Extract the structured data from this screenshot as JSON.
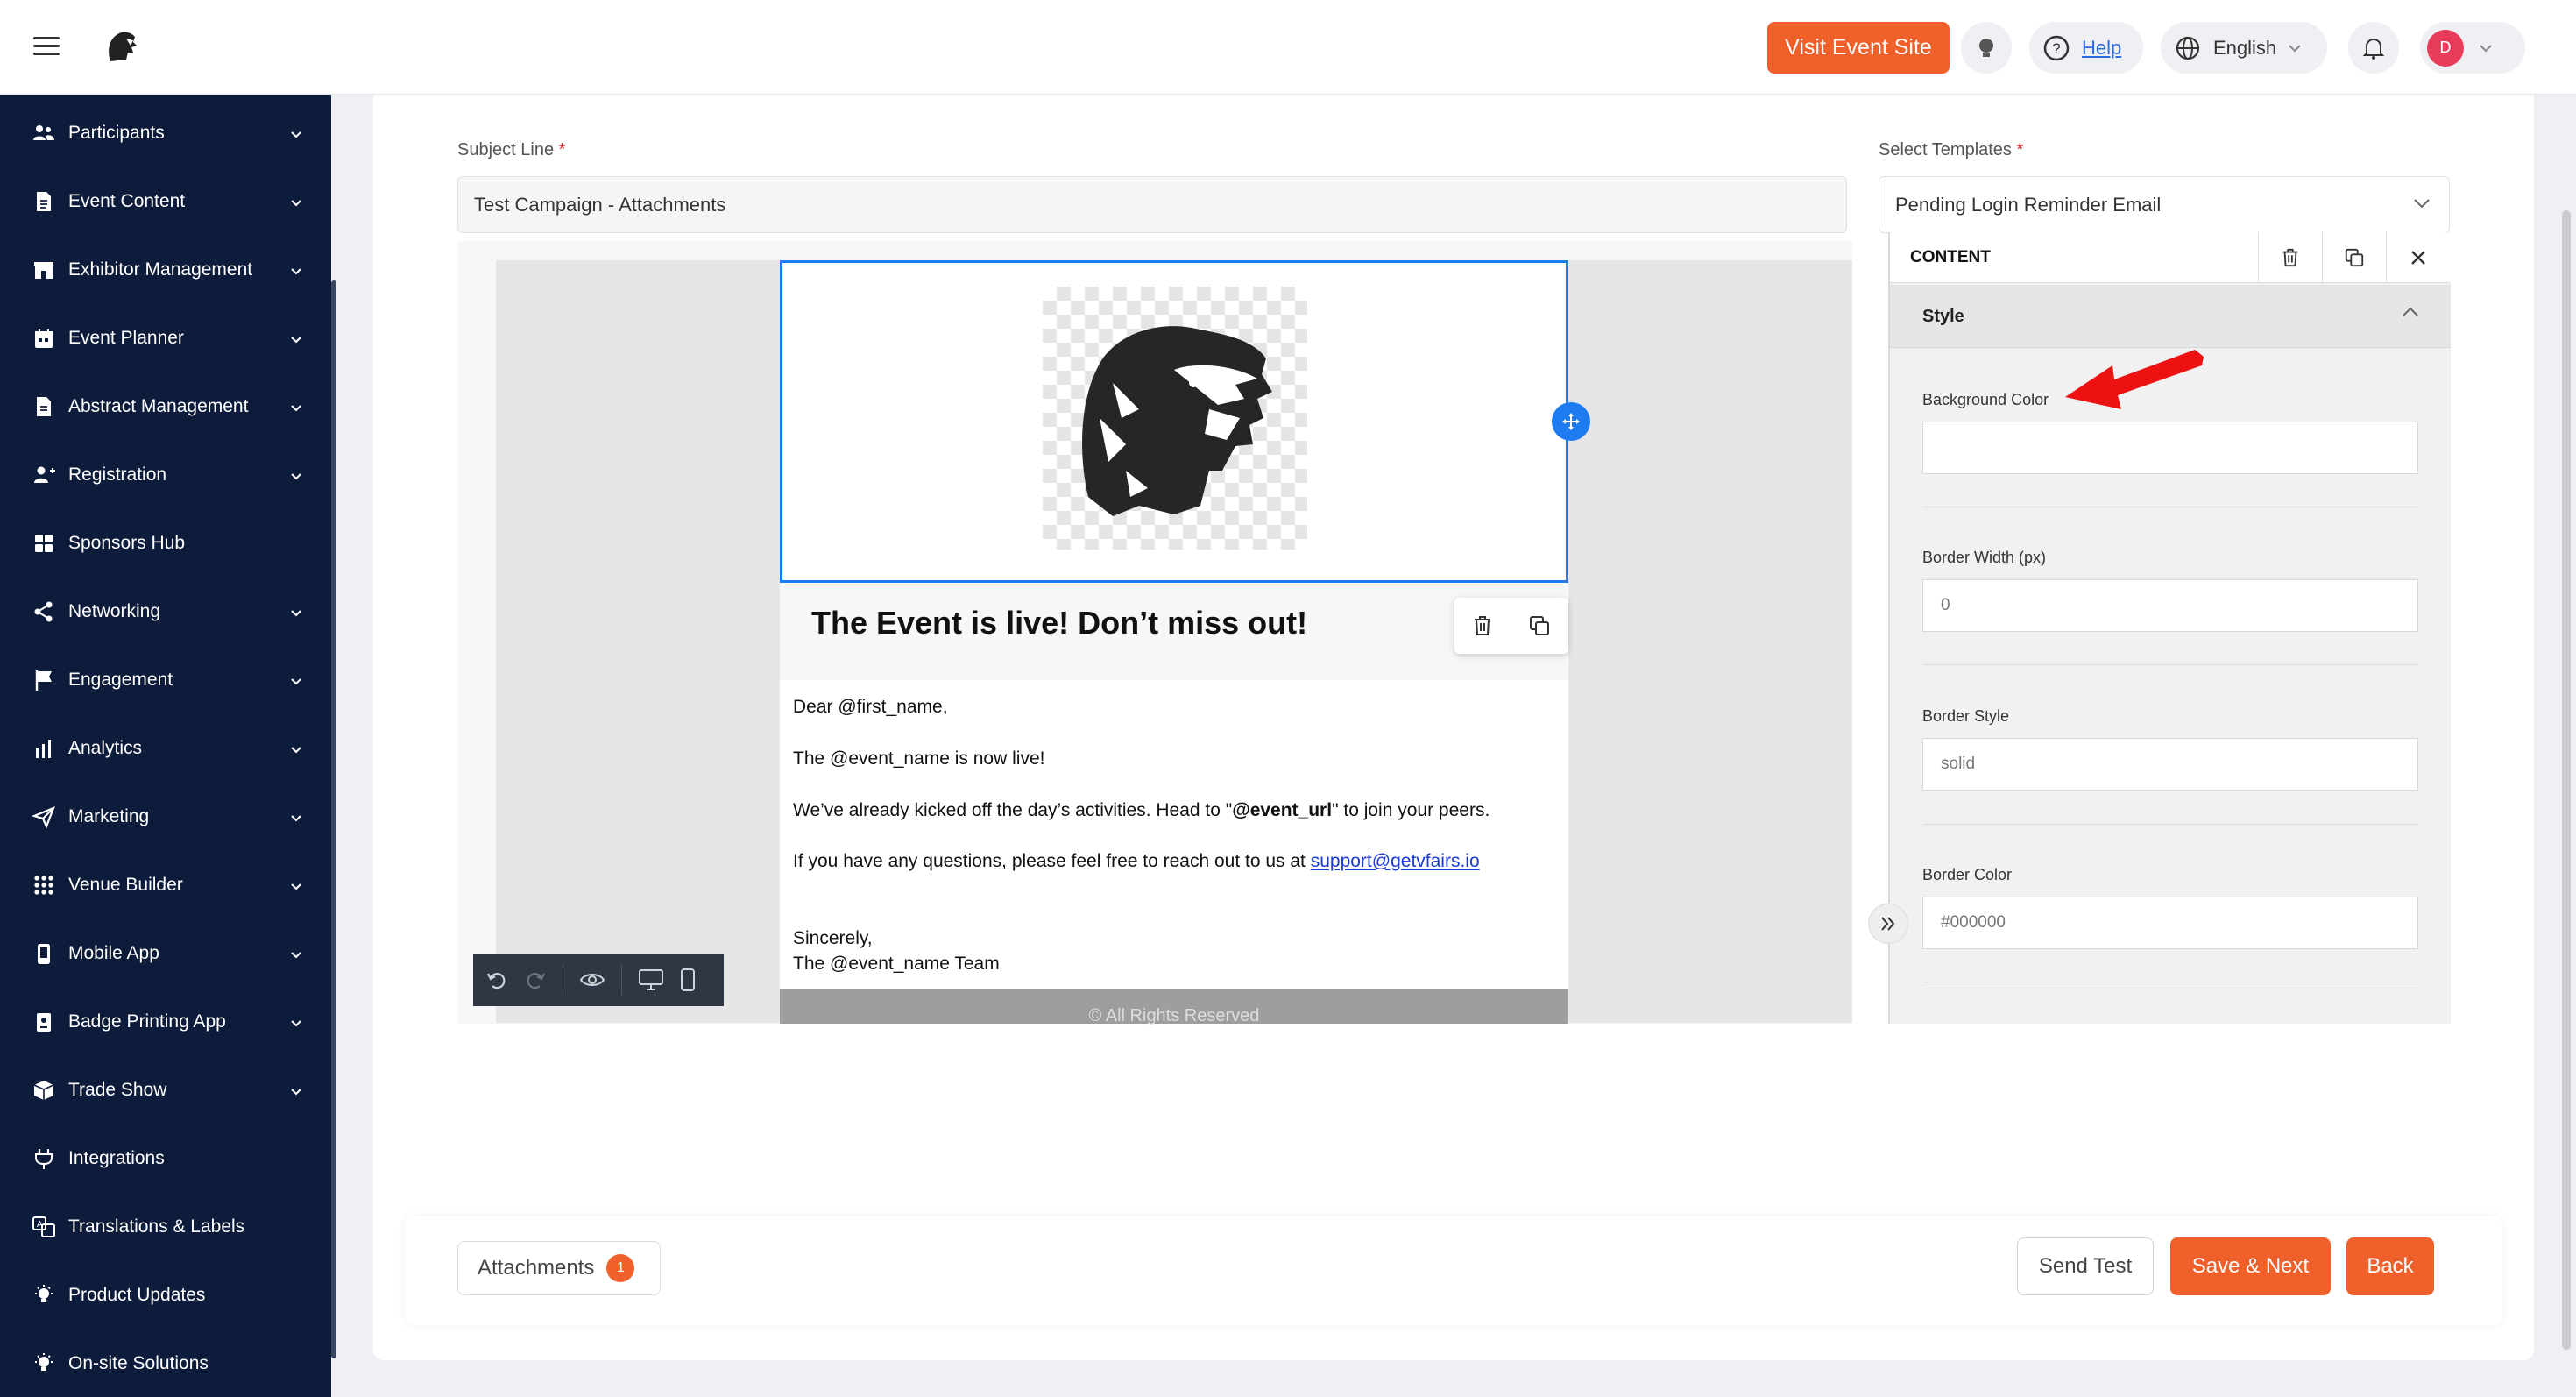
{
  "topbar": {
    "visit_label": "Visit Event Site",
    "help_label": "Help",
    "language": "English",
    "user_initial": "D",
    "accent": "#f0602a"
  },
  "sidebar": {
    "items": [
      {
        "label": "Participants",
        "icon": "users-icon",
        "chevron": true
      },
      {
        "label": "Event Content",
        "icon": "document-icon",
        "chevron": true
      },
      {
        "label": "Exhibitor Management",
        "icon": "booth-icon",
        "chevron": true
      },
      {
        "label": "Event Planner",
        "icon": "calendar-icon",
        "chevron": true
      },
      {
        "label": "Abstract Management",
        "icon": "file-icon",
        "chevron": true
      },
      {
        "label": "Registration",
        "icon": "user-plus-icon",
        "chevron": true
      },
      {
        "label": "Sponsors Hub",
        "icon": "grid-icon",
        "chevron": false
      },
      {
        "label": "Networking",
        "icon": "share-icon",
        "chevron": true
      },
      {
        "label": "Engagement",
        "icon": "flag-icon",
        "chevron": true
      },
      {
        "label": "Analytics",
        "icon": "bar-chart-icon",
        "chevron": true
      },
      {
        "label": "Marketing",
        "icon": "send-icon",
        "chevron": true
      },
      {
        "label": "Venue Builder",
        "icon": "dots-grid-icon",
        "chevron": true
      },
      {
        "label": "Mobile App",
        "icon": "mobile-icon",
        "chevron": true
      },
      {
        "label": "Badge Printing App",
        "icon": "badge-icon",
        "chevron": true
      },
      {
        "label": "Trade Show",
        "icon": "box-icon",
        "chevron": true
      },
      {
        "label": "Integrations",
        "icon": "plug-icon",
        "chevron": false
      },
      {
        "label": "Translations & Labels",
        "icon": "translate-icon",
        "chevron": false
      },
      {
        "label": "Product Updates",
        "icon": "lightbulb-icon",
        "chevron": false
      },
      {
        "label": "On-site Solutions",
        "icon": "lightbulb-icon",
        "chevron": false
      }
    ]
  },
  "form": {
    "subject_label": "Subject Line",
    "subject_value": "Test Campaign - Attachments",
    "template_label": "Select Templates",
    "template_value": "Pending Login Reminder Email",
    "required_mark": "*"
  },
  "email": {
    "headline": "The Event is live! Don’t miss out!",
    "greeting": "Dear @first_name,",
    "line1": "The @event_name is now live!",
    "line2_pre": "We’ve already kicked off the day’s activities. Head to \"",
    "line2_bold": "@event_url",
    "line2_post": "\" to join your peers.",
    "line3_pre": "If you have any questions, please feel free to reach out to us at ",
    "line3_link": "support@getvfairs.io",
    "signoff": "Sincerely,",
    "team": "The @event_name Team",
    "footer": "© All Rights Reserved"
  },
  "panel": {
    "tab": "CONTENT",
    "section": "Style",
    "bg_color_label": "Background Color",
    "bg_color_value": "",
    "border_width_label": "Border Width (px)",
    "border_width_value": "0",
    "border_style_label": "Border Style",
    "border_style_value": "solid",
    "border_color_label": "Border Color",
    "border_color_value": "#000000"
  },
  "bottom": {
    "attachments_label": "Attachments",
    "attachments_count": "1",
    "send_test": "Send Test",
    "save_next": "Save & Next",
    "back": "Back"
  }
}
